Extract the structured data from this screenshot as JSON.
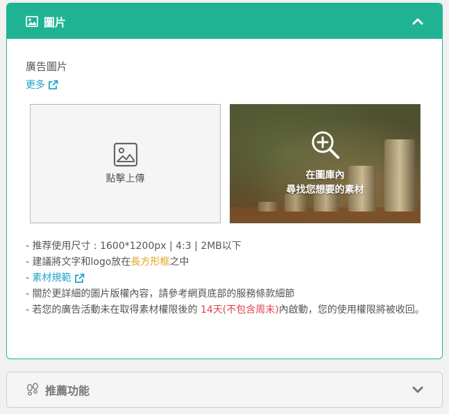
{
  "image_panel": {
    "title": "圖片",
    "field_label": "廣告圖片",
    "more_link": "更多",
    "upload_label": "點擊上傳",
    "library_line1": "在圖庫內",
    "library_line2": "尋找您想要的素材",
    "notes": {
      "line1": "- 推荐使用尺寸 : 1600*1200px | 4:3 | 2MB以下",
      "line2_pre": "- 建議將文字和logo放在",
      "line2_hl": "長方形框",
      "line2_post": "之中",
      "line3_dash": "- ",
      "line3_link": "素材規範",
      "line4": "- 關於更詳細的圖片版權內容，請參考網頁底部的服務條款細節",
      "line5_pre": "- 若您的廣告活動未在取得素材權限後的 ",
      "line5_hl": "14天(不包含周末)",
      "line5_post": "內啟動，您的使用權限將被收回。"
    }
  },
  "recommend_panel": {
    "title": "推薦功能"
  },
  "colors": {
    "accent": "#1fb394",
    "link": "#22a3c7",
    "highlight_orange": "#e0a21b",
    "highlight_red": "#e0414e"
  }
}
